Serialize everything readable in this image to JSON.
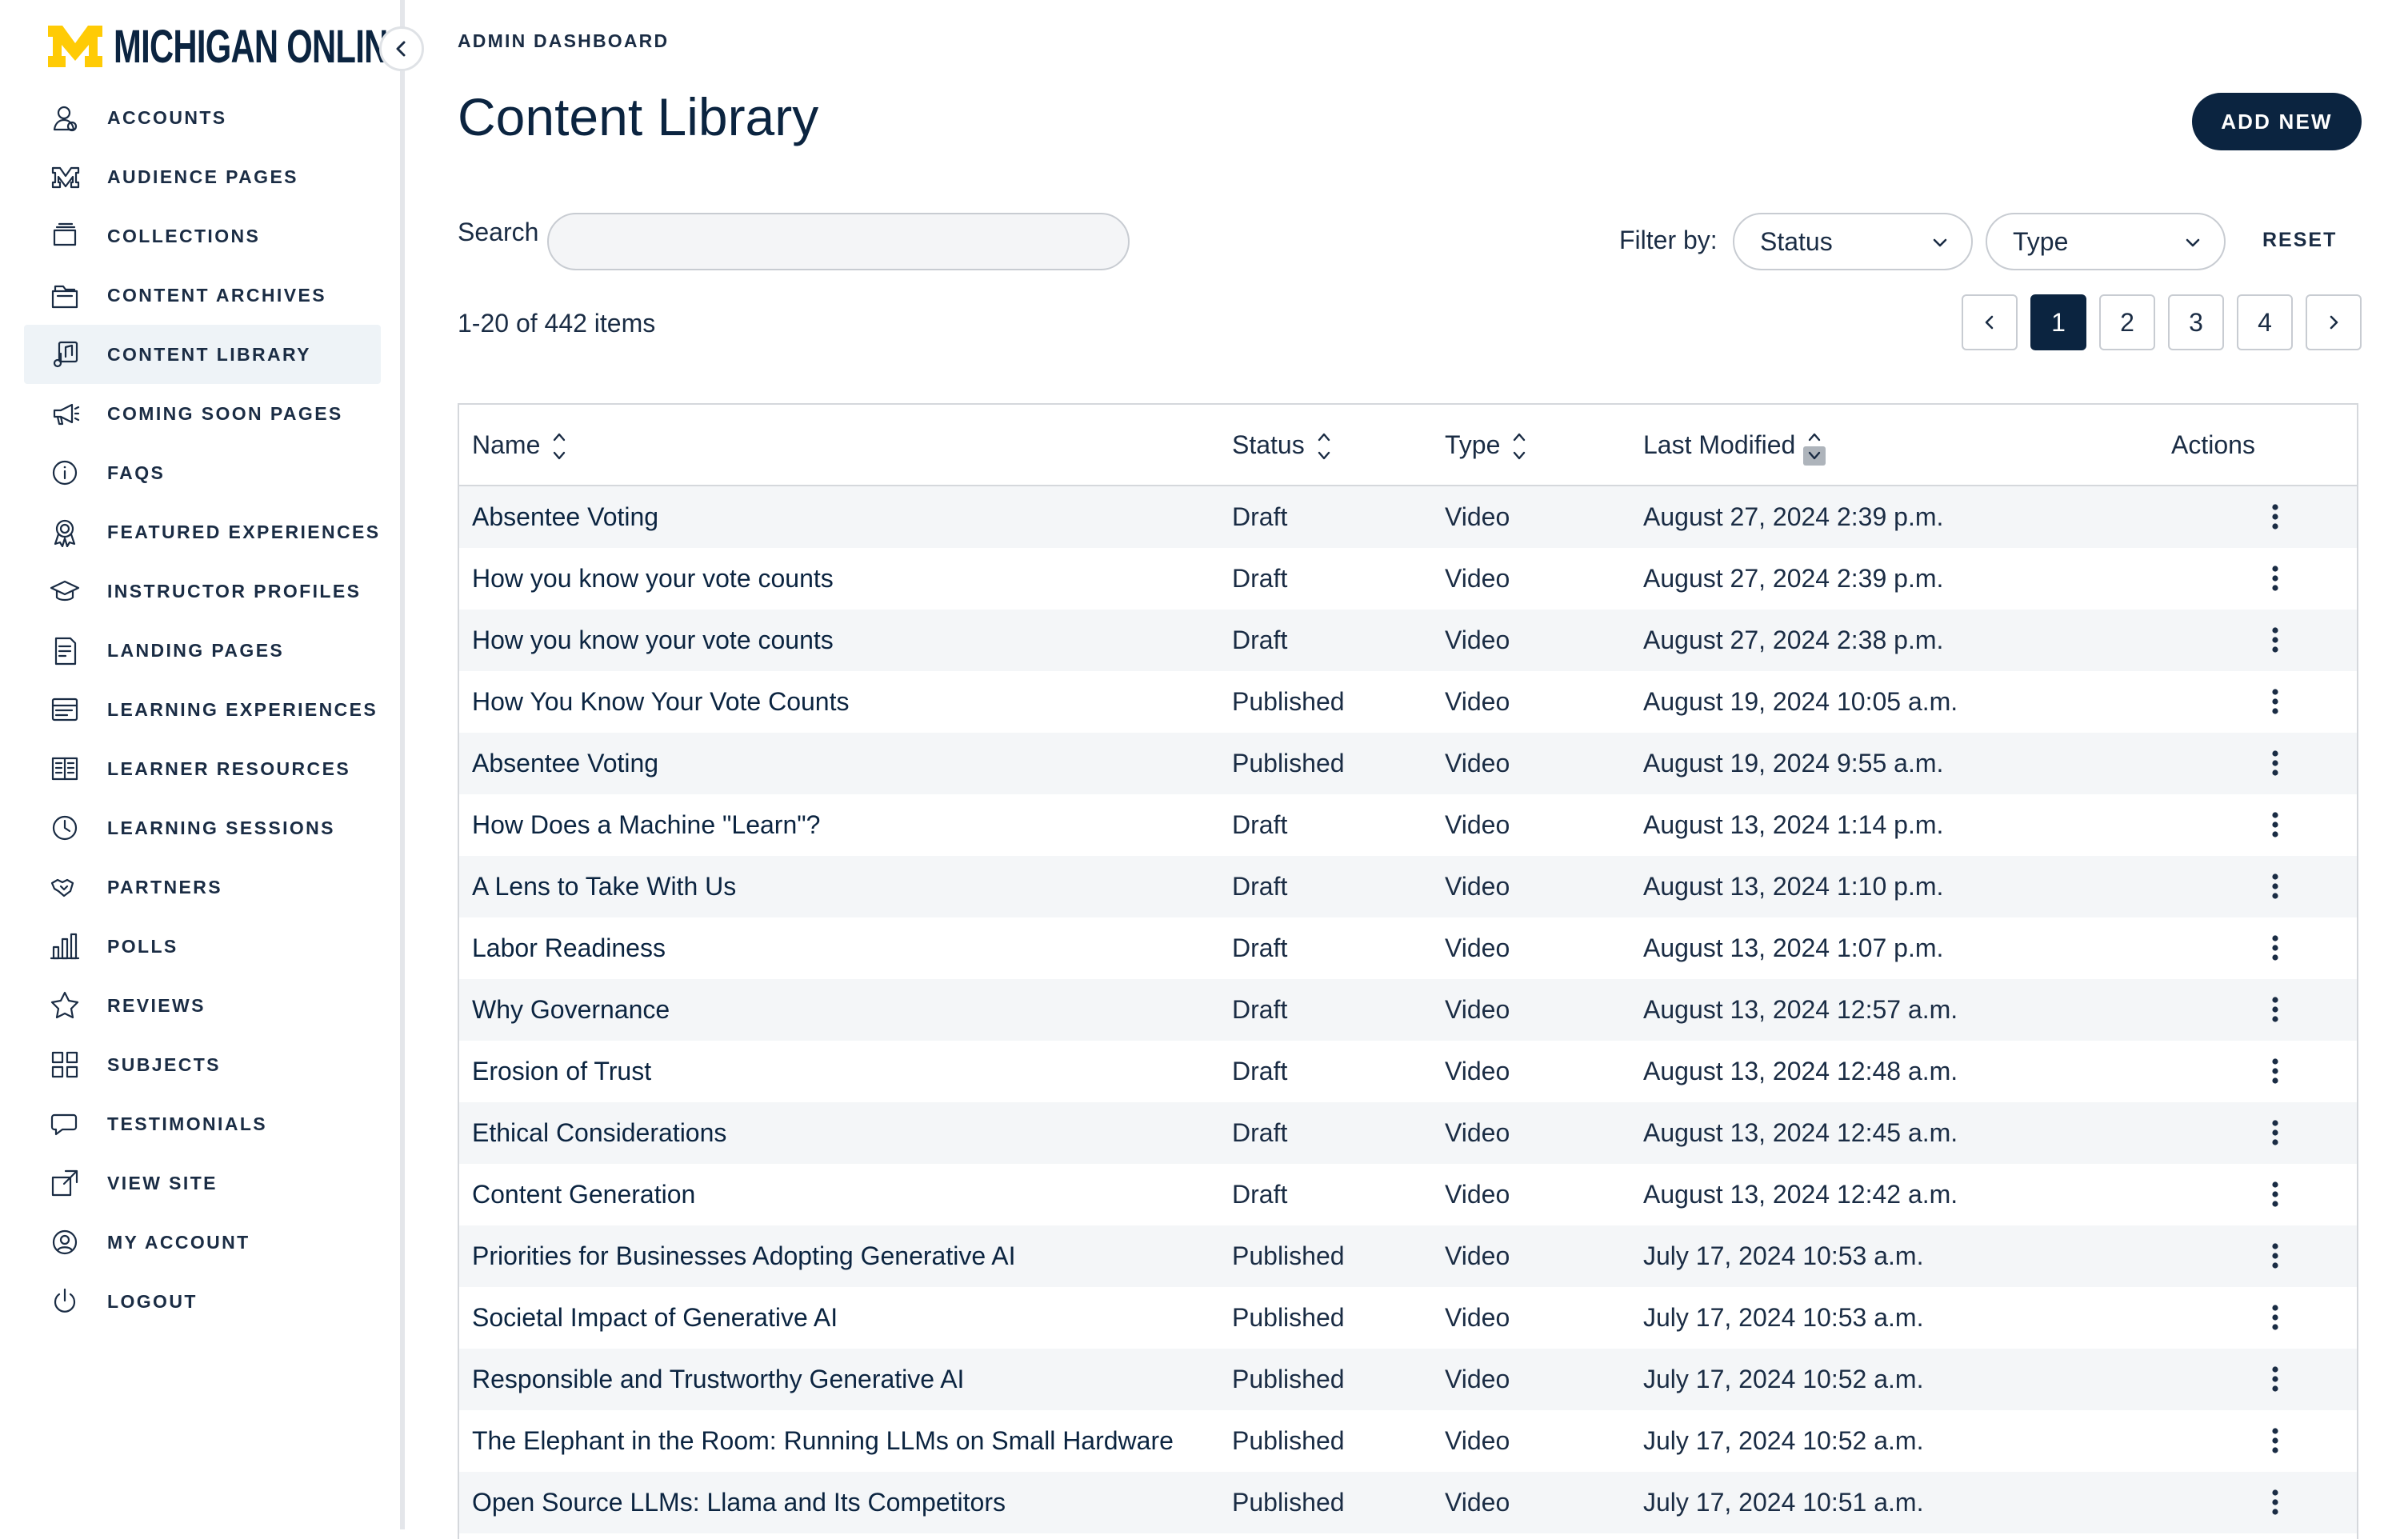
{
  "brand": {
    "logo_text": "MICHIGAN ONLINE",
    "maize": "#ffcb05",
    "navy": "#0b2440"
  },
  "sidebar": {
    "items": [
      {
        "label": "ACCOUNTS",
        "icon": "accounts-icon"
      },
      {
        "label": "AUDIENCE PAGES",
        "icon": "m-block-icon"
      },
      {
        "label": "COLLECTIONS",
        "icon": "collection-icon"
      },
      {
        "label": "CONTENT ARCHIVES",
        "icon": "archive-icon"
      },
      {
        "label": "CONTENT LIBRARY",
        "icon": "music-note-icon",
        "active": true
      },
      {
        "label": "COMING SOON PAGES",
        "icon": "megaphone-icon"
      },
      {
        "label": "FAQS",
        "icon": "info-icon"
      },
      {
        "label": "FEATURED EXPERIENCES",
        "icon": "award-icon"
      },
      {
        "label": "INSTRUCTOR PROFILES",
        "icon": "graduation-cap-icon"
      },
      {
        "label": "LANDING PAGES",
        "icon": "page-icon"
      },
      {
        "label": "LEARNING EXPERIENCES",
        "icon": "card-icon"
      },
      {
        "label": "LEARNER RESOURCES",
        "icon": "book-icon"
      },
      {
        "label": "LEARNING SESSIONS",
        "icon": "clock-icon"
      },
      {
        "label": "PARTNERS",
        "icon": "handshake-icon"
      },
      {
        "label": "POLLS",
        "icon": "bar-chart-icon"
      },
      {
        "label": "REVIEWS",
        "icon": "star-icon"
      },
      {
        "label": "SUBJECTS",
        "icon": "grid-icon"
      },
      {
        "label": "TESTIMONIALS",
        "icon": "chat-icon"
      },
      {
        "label": "VIEW SITE",
        "icon": "external-link-icon"
      },
      {
        "label": "MY ACCOUNT",
        "icon": "user-circle-icon"
      },
      {
        "label": "LOGOUT",
        "icon": "power-icon"
      }
    ]
  },
  "header": {
    "eyebrow": "ADMIN DASHBOARD",
    "title": "Content Library",
    "add_label": "ADD NEW"
  },
  "toolbar": {
    "search_label": "Search",
    "search_value": "",
    "filter_label": "Filter by:",
    "status_value": "Status",
    "type_value": "Type",
    "reset_label": "RESET"
  },
  "pagination": {
    "summary": "1-20 of 442 items",
    "pages": [
      "1",
      "2",
      "3",
      "4"
    ],
    "current": "1"
  },
  "table": {
    "columns": [
      "Name",
      "Status",
      "Type",
      "Last Modified",
      "Actions"
    ],
    "rows": [
      {
        "name": "Absentee Voting",
        "status": "Draft",
        "type": "Video",
        "modified": "August 27, 2024 2:39 p.m."
      },
      {
        "name": "How you know your vote counts",
        "status": "Draft",
        "type": "Video",
        "modified": "August 27, 2024 2:39 p.m."
      },
      {
        "name": "How you know your vote counts",
        "status": "Draft",
        "type": "Video",
        "modified": "August 27, 2024 2:38 p.m."
      },
      {
        "name": "How You Know Your Vote Counts",
        "status": "Published",
        "type": "Video",
        "modified": "August 19, 2024 10:05 a.m."
      },
      {
        "name": "Absentee Voting",
        "status": "Published",
        "type": "Video",
        "modified": "August 19, 2024 9:55 a.m."
      },
      {
        "name": "How Does a Machine \"Learn\"?",
        "status": "Draft",
        "type": "Video",
        "modified": "August 13, 2024 1:14 p.m."
      },
      {
        "name": "A Lens to Take With Us",
        "status": "Draft",
        "type": "Video",
        "modified": "August 13, 2024 1:10 p.m."
      },
      {
        "name": "Labor Readiness",
        "status": "Draft",
        "type": "Video",
        "modified": "August 13, 2024 1:07 p.m."
      },
      {
        "name": "Why Governance",
        "status": "Draft",
        "type": "Video",
        "modified": "August 13, 2024 12:57 a.m."
      },
      {
        "name": "Erosion of Trust",
        "status": "Draft",
        "type": "Video",
        "modified": "August 13, 2024 12:48 a.m."
      },
      {
        "name": "Ethical Considerations",
        "status": "Draft",
        "type": "Video",
        "modified": "August 13, 2024 12:45 a.m."
      },
      {
        "name": "Content Generation",
        "status": "Draft",
        "type": "Video",
        "modified": "August 13, 2024 12:42 a.m."
      },
      {
        "name": "Priorities for Businesses Adopting Generative AI",
        "status": "Published",
        "type": "Video",
        "modified": "July 17, 2024 10:53 a.m."
      },
      {
        "name": "Societal Impact of Generative AI",
        "status": "Published",
        "type": "Video",
        "modified": "July 17, 2024 10:53 a.m."
      },
      {
        "name": "Responsible and Trustworthy Generative AI",
        "status": "Published",
        "type": "Video",
        "modified": "July 17, 2024 10:52 a.m."
      },
      {
        "name": "The Elephant in the Room: Running LLMs on Small Hardware",
        "status": "Published",
        "type": "Video",
        "modified": "July 17, 2024 10:52 a.m."
      },
      {
        "name": "Open Source LLMs: Llama and Its Competitors",
        "status": "Published",
        "type": "Video",
        "modified": "July 17, 2024 10:51 a.m."
      },
      {
        "name": "",
        "status": "",
        "type": "",
        "modified": ""
      }
    ]
  }
}
